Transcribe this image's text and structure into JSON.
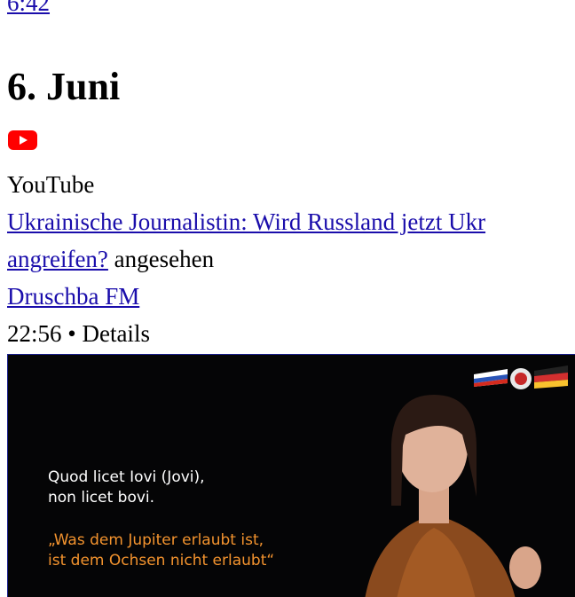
{
  "previous_entry": {
    "time": "6:42"
  },
  "day": {
    "heading": "6. Juni"
  },
  "entry": {
    "icon": "youtube-icon",
    "source": "YouTube",
    "title_line1": "Ukrainische Journalistin: Wird Russland jetzt Ukr",
    "title_line2": "angreifen?",
    "action": "angesehen",
    "channel": "Druschba FM",
    "time": "22:56",
    "separator": "•",
    "details": "Details"
  },
  "thumbnail": {
    "caption_latin_1": "Quod licet Iovi (Jovi),",
    "caption_latin_2": "non licet bovi.",
    "caption_german_1": "„Was dem Jupiter erlaubt ist,",
    "caption_german_2": "ist dem Ochsen nicht erlaubt“"
  },
  "colors": {
    "link": "#1a0dab",
    "youtube_red": "#ff0000",
    "caption_orange": "#f3932e"
  }
}
